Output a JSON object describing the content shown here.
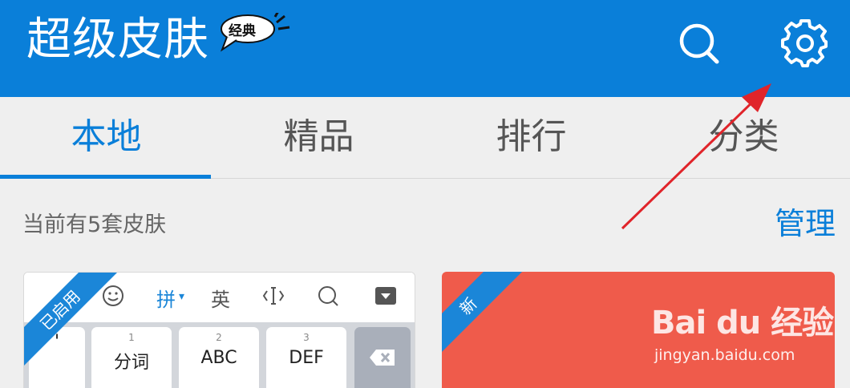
{
  "header": {
    "title": "超级皮肤",
    "badge": "经典"
  },
  "tabs": [
    {
      "label": "本地",
      "active": true
    },
    {
      "label": "精品",
      "active": false
    },
    {
      "label": "排行",
      "active": false
    },
    {
      "label": "分类",
      "active": false
    }
  ],
  "info": {
    "count_text": "当前有5套皮肤",
    "manage_label": "管理"
  },
  "skins": [
    {
      "ribbon": "已启用",
      "toolbar": [
        "拼",
        "英"
      ],
      "keys": [
        {
          "num": "",
          "label": "'"
        },
        {
          "num": "1",
          "label": "分词"
        },
        {
          "num": "2",
          "label": "ABC"
        },
        {
          "num": "3",
          "label": "DEF"
        }
      ]
    },
    {
      "ribbon": "新"
    }
  ],
  "watermark": {
    "main": "Bai du 经验",
    "sub": "jingyan.baidu.com"
  },
  "colors": {
    "primary": "#0a7fd9",
    "annotation_arrow": "#e0242a",
    "card2_bg": "#ef5b4b"
  }
}
